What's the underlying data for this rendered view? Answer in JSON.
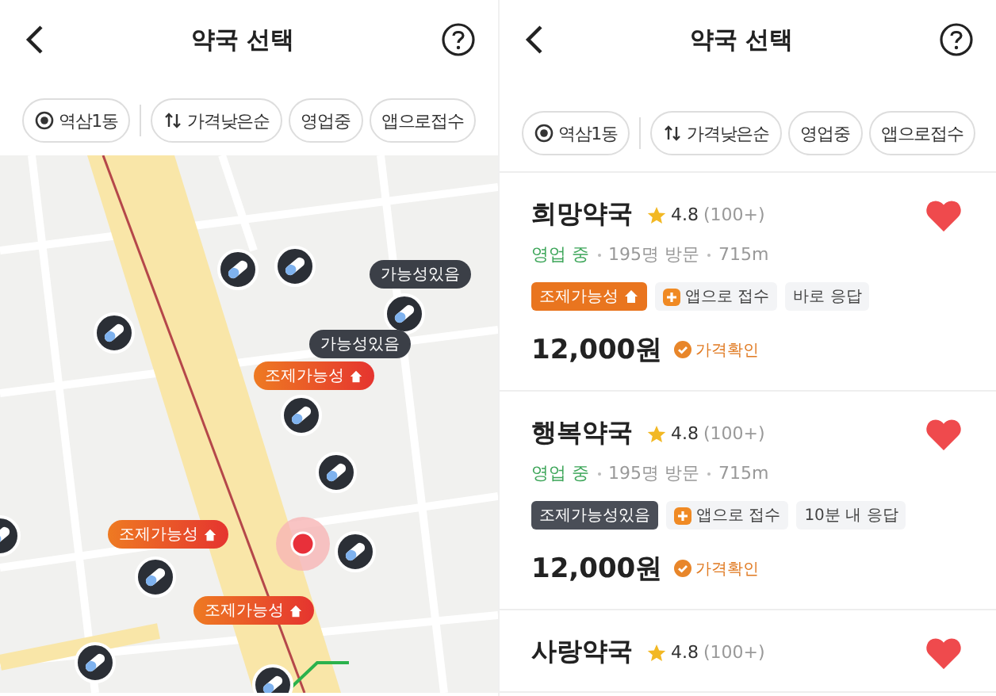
{
  "map_screen": {
    "title": "약국 선택",
    "filters": [
      {
        "kind": "location",
        "label": "역삼1동"
      },
      {
        "kind": "sort",
        "label": "가격낮은순"
      },
      {
        "kind": "plain",
        "label": "영업중"
      },
      {
        "kind": "plain",
        "label": "앱으로접수"
      }
    ],
    "map_labels": [
      {
        "kind": "possible",
        "label": "가능성있음"
      },
      {
        "kind": "possible",
        "label": "가능성있음"
      },
      {
        "kind": "prescribe",
        "label": "조제가능성"
      },
      {
        "kind": "prescribe",
        "label": "조제가능성"
      },
      {
        "kind": "prescribe",
        "label": "조제가능성"
      }
    ]
  },
  "list_screen": {
    "title": "약국 선택",
    "filters": [
      {
        "kind": "location",
        "label": "역삼1동"
      },
      {
        "kind": "sort",
        "label": "가격낮은순"
      },
      {
        "kind": "plain",
        "label": "영업중"
      },
      {
        "kind": "plain",
        "label": "앱으로접수"
      }
    ],
    "pharmacies": [
      {
        "name": "희망약국",
        "rating": "4.8",
        "reviews": "(100+)",
        "status": "영업 중",
        "visits": "195명 방문",
        "distance": "715m",
        "tags": [
          {
            "kind": "prescribe",
            "label": "조제가능성"
          },
          {
            "kind": "app",
            "label": "앱으로 접수"
          },
          {
            "kind": "plain",
            "label": "바로 응답"
          }
        ],
        "price": "12,000원",
        "price_badge": "가격확인",
        "favorite": true
      },
      {
        "name": "행복약국",
        "rating": "4.8",
        "reviews": "(100+)",
        "status": "영업 중",
        "visits": "195명 방문",
        "distance": "715m",
        "tags": [
          {
            "kind": "possible",
            "label": "조제가능성있음"
          },
          {
            "kind": "app",
            "label": "앱으로 접수"
          },
          {
            "kind": "plain",
            "label": "10분 내 응답"
          }
        ],
        "price": "12,000원",
        "price_badge": "가격확인",
        "favorite": true
      },
      {
        "name": "사랑약국",
        "rating": "4.8",
        "reviews": "(100+)",
        "favorite": true
      }
    ]
  }
}
